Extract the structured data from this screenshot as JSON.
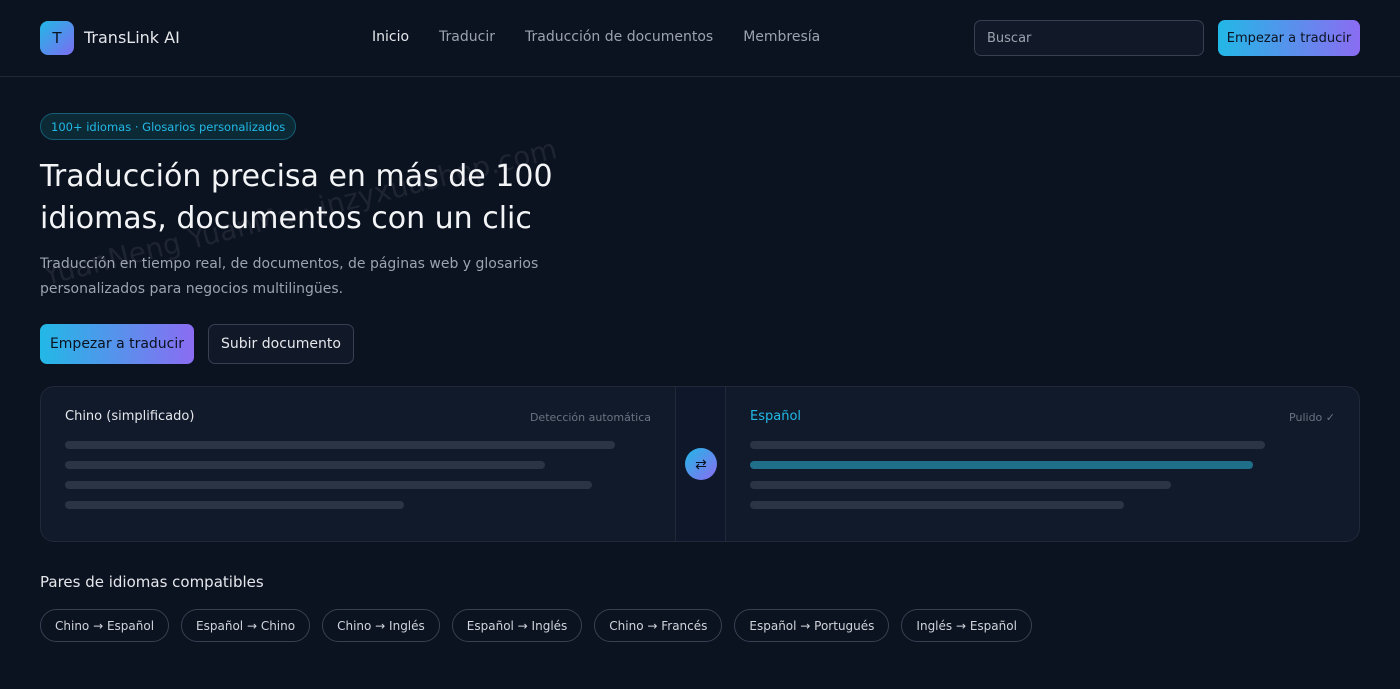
{
  "header": {
    "logo_letter": "T",
    "brand": "TransLink AI",
    "nav": [
      {
        "label": "Inicio",
        "active": true
      },
      {
        "label": "Traducir",
        "active": false
      },
      {
        "label": "Traducción de documentos",
        "active": false
      },
      {
        "label": "Membresía",
        "active": false
      }
    ],
    "search_placeholder": "Buscar",
    "cta_label": "Empezar a traducir"
  },
  "hero": {
    "badge": "100+ idiomas · Glosarios personalizados",
    "title": "Traducción precisa en más de 100 idiomas, documentos con un clic",
    "subtitle": "Traducción en tiempo real, de documentos, de páginas web y glosarios personalizados para negocios multilingües.",
    "primary_button": "Empezar a traducir",
    "secondary_button": "Subir documento"
  },
  "translator": {
    "source_language": "Chino (simplificado)",
    "source_note": "Detección automática",
    "target_language": "Español",
    "target_note": "Pulido ✓",
    "swap_icon": "⇄"
  },
  "pairs": {
    "title": "Pares de idiomas compatibles",
    "items": [
      "Chino → Español",
      "Español → Chino",
      "Chino → Inglés",
      "Español → Inglés",
      "Chino → Francés",
      "Español → Portugués",
      "Inglés → Español"
    ]
  },
  "watermark": "YuanNeng YuanMa · inzyxuashop.com",
  "colors": {
    "background": "#0b1220",
    "accent_start": "#22b8e6",
    "accent_end": "#8b6cf2"
  }
}
